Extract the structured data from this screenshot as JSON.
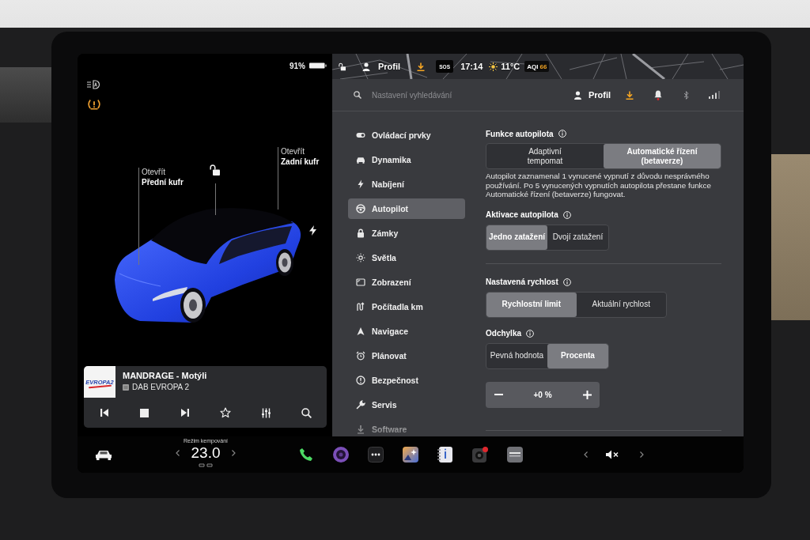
{
  "vehicle_panel": {
    "battery_text": "91%",
    "front_trunk": {
      "action": "Otevřít",
      "label": "Přední kufr"
    },
    "rear_trunk": {
      "action": "Otevřít",
      "label": "Zadní kufr"
    }
  },
  "media_player": {
    "logo_text": "EVROPA2",
    "title": "MANDRAGE - Motýli",
    "source": "DAB EVROPA 2"
  },
  "map_status_bar": {
    "profile": "Profil",
    "sos": "SOS",
    "time": "17:14",
    "temperature": "11°C",
    "aqi_label": "AQI",
    "aqi_value": "66"
  },
  "settings": {
    "search": {
      "placeholder": "Nastavení vyhledávání"
    },
    "profile": "Profil",
    "menu": [
      {
        "label": "Ovládací prvky",
        "selected": false
      },
      {
        "label": "Dynamika",
        "selected": false
      },
      {
        "label": "Nabíjení",
        "selected": false
      },
      {
        "label": "Autopilot",
        "selected": true
      },
      {
        "label": "Zámky",
        "selected": false
      },
      {
        "label": "Světla",
        "selected": false
      },
      {
        "label": "Zobrazení",
        "selected": false
      },
      {
        "label": "Počítadla km",
        "selected": false
      },
      {
        "label": "Navigace",
        "selected": false
      },
      {
        "label": "Plánovat",
        "selected": false
      },
      {
        "label": "Bezpečnost",
        "selected": false
      },
      {
        "label": "Servis",
        "selected": false
      },
      {
        "label": "Software",
        "selected": false
      }
    ],
    "groups": [
      {
        "sections": [
          {
            "title": "Funkce autopilota",
            "options": [
              {
                "label": "Adaptivní\ntempomat",
                "selected": false
              },
              {
                "label": "Automatické řízení\n(betaverze)",
                "selected": true
              }
            ],
            "note": "Autopilot zaznamenal 1 vynucené vypnutí z důvodu nesprávného používání. Po 5 vynucených vypnutích autopilota přestane funkce Automatické řízení (betaverze) fungovat."
          },
          {
            "title": "Aktivace autopilota",
            "options": [
              {
                "label": "Jedno zatažení",
                "selected": true
              },
              {
                "label": "Dvojí zatažení",
                "selected": false
              }
            ]
          }
        ]
      },
      {
        "sections": [
          {
            "title": "Nastavená rychlost",
            "options": [
              {
                "label": "Rychlostní limit",
                "selected": true
              },
              {
                "label": "Aktuální rychlost",
                "selected": false
              }
            ]
          },
          {
            "title": "Odchylka",
            "options": [
              {
                "label": "Pevná hodnota",
                "selected": false
              },
              {
                "label": "Procenta",
                "selected": true
              }
            ],
            "stepper": {
              "value": "+0 %"
            }
          }
        ]
      }
    ]
  },
  "dock": {
    "climate_mode": "Režim kempování",
    "temperature": "23.0"
  }
}
